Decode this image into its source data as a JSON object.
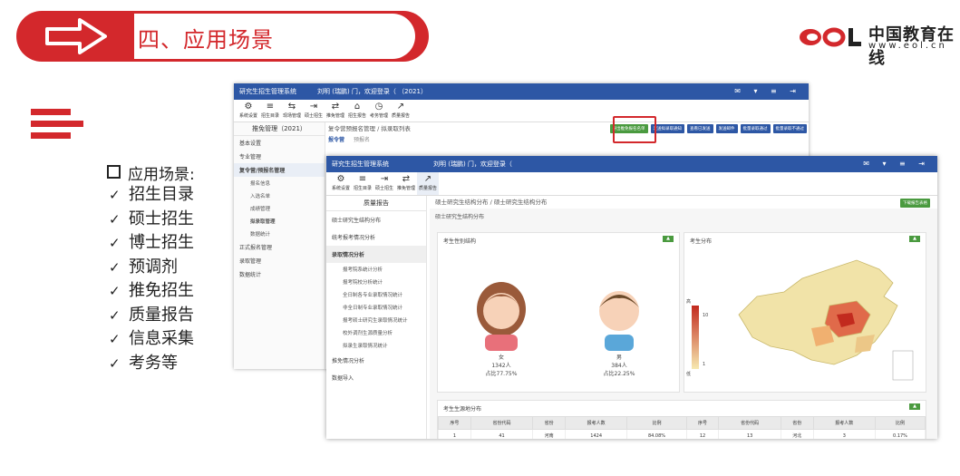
{
  "header": {
    "title": "四、应用场景",
    "logo_text": "中国教育在线",
    "logo_url": "www.eol.cn",
    "accent": "#d3282c"
  },
  "scenes": {
    "title": "应用场景:",
    "items": [
      "招生目录",
      "硕士招生",
      "博士招生",
      "预调剂",
      "推免招生",
      "质量报告",
      "信息采集",
      "考务等"
    ],
    "check": "✓"
  },
  "screen1": {
    "app_title": "研究生招生管理系统",
    "user_text": "刘明 (瑞鹏) 门，欢迎登录（ （2021）",
    "toolbar": [
      "系统设置",
      "招生目录",
      "现场管理",
      "硕士招生",
      "推免管理",
      "招生报告",
      "考务管理",
      "质量报告"
    ],
    "sidebar_header": "推免管理（2021）",
    "sidebar": [
      "基本设置",
      "专业管理",
      "复令营/预报名管理"
    ],
    "sidebar_sub": [
      "报名信息",
      "入选名单",
      "成绩管理",
      "拟录取管理",
      "数据统计"
    ],
    "sidebar_more": [
      "正式报名管理",
      "录取管理",
      "数据统计"
    ],
    "crumb": "复令营预报名管理 / 拟录取列表",
    "tabs": [
      "报令营",
      "预报名"
    ],
    "buttons": [
      "导出推免报名名单",
      "发送拟录取通知",
      "查看已发送",
      "发送邮件",
      "批量录取通过",
      "批量录取不通过"
    ]
  },
  "screen2": {
    "app_title": "研究生招生管理系统",
    "user_text": "刘明 (瑞鹏) 门，欢迎登录（",
    "toolbar": [
      "系统设置",
      "招生目录",
      "硕士招生",
      "推免管理",
      "质量报告"
    ],
    "sidebar_header": "质量报告",
    "sidebar": [
      "硕士研究生结构分布",
      "统考报考情况分析",
      "录取情况分析"
    ],
    "sidebar_sub": [
      "报考院系统计分析",
      "报考院校分析统计",
      "全日制各专业录取情况统计",
      "非全日制专业录取情况统计",
      "报考硕士研究生录取情况统计",
      "校外调剂生源质量分析",
      "拟录生录取情况统计"
    ],
    "sidebar_more": [
      "推免情况分析",
      "数据导入"
    ],
    "crumb": "硕士研究生结构分布 / 硕士研究生结构分布",
    "section": "硕士研究生结构分布",
    "export_btn": "下载报告表格",
    "gender_panel": "考生性别结构",
    "region_panel": "考生分布",
    "female": {
      "label": "女",
      "count": "1342人",
      "ratio": "占比77.75%"
    },
    "male": {
      "label": "男",
      "count": "384人",
      "ratio": "占比22.25%"
    },
    "map_legend": {
      "high": "高",
      "mid": "10",
      "low": "1",
      "low_label": "低"
    },
    "table_title": "考生生源地分布",
    "table_headers": [
      "序号",
      "省份代码",
      "省份",
      "报考人数",
      "比例",
      "序号",
      "省份代码",
      "省份",
      "报考人数",
      "比例"
    ],
    "table_row": [
      "1",
      "41",
      "河南",
      "1424",
      "84.08%",
      "12",
      "13",
      "河北",
      "3",
      "0.17%"
    ]
  }
}
